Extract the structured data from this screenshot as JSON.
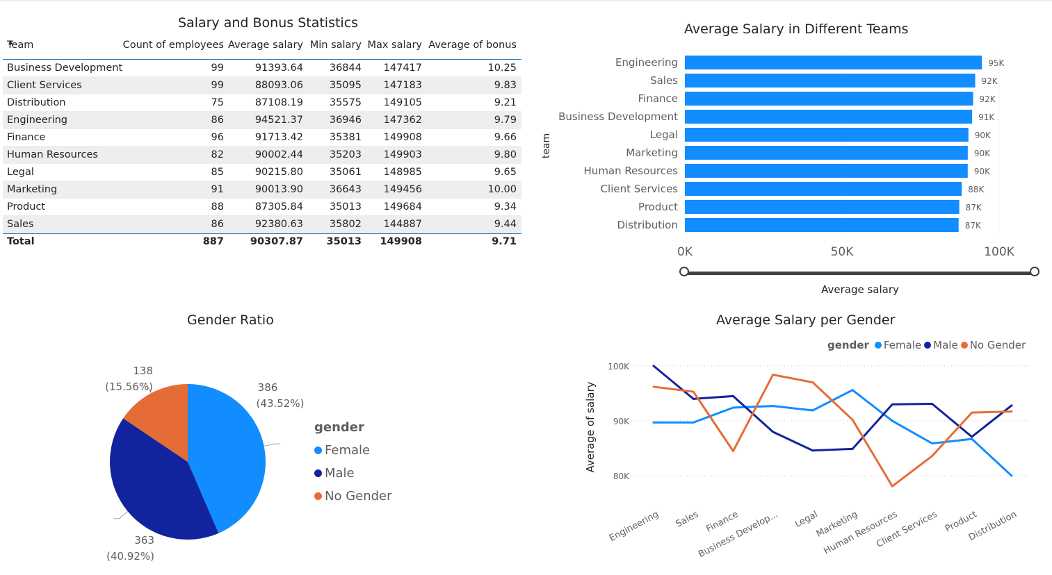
{
  "table": {
    "title": "Salary and Bonus Statistics",
    "columns": [
      "Team",
      "Count of employees",
      "Average salary",
      "Min salary",
      "Max salary",
      "Average of bonus"
    ],
    "rows": [
      [
        "Business Development",
        "99",
        "91393.64",
        "36844",
        "147417",
        "10.25"
      ],
      [
        "Client Services",
        "99",
        "88093.06",
        "35095",
        "147183",
        "9.83"
      ],
      [
        "Distribution",
        "75",
        "87108.19",
        "35575",
        "149105",
        "9.21"
      ],
      [
        "Engineering",
        "86",
        "94521.37",
        "36946",
        "147362",
        "9.79"
      ],
      [
        "Finance",
        "96",
        "91713.42",
        "35381",
        "149908",
        "9.66"
      ],
      [
        "Human Resources",
        "82",
        "90002.44",
        "35203",
        "149903",
        "9.80"
      ],
      [
        "Legal",
        "85",
        "90215.80",
        "35061",
        "148985",
        "9.65"
      ],
      [
        "Marketing",
        "91",
        "90013.90",
        "36643",
        "149456",
        "10.00"
      ],
      [
        "Product",
        "88",
        "87305.84",
        "35013",
        "149684",
        "9.34"
      ],
      [
        "Sales",
        "86",
        "92380.63",
        "35802",
        "144887",
        "9.44"
      ]
    ],
    "total": [
      "Total",
      "887",
      "90307.87",
      "35013",
      "149908",
      "9.71"
    ]
  },
  "chart_data": [
    {
      "type": "bar",
      "orientation": "horizontal",
      "title": "Average Salary in Different Teams",
      "ylabel": "team",
      "xlabel": "Average salary",
      "categories": [
        "Engineering",
        "Sales",
        "Finance",
        "Business Development",
        "Legal",
        "Marketing",
        "Human Resources",
        "Client Services",
        "Product",
        "Distribution"
      ],
      "values": [
        94521.37,
        92380.63,
        91713.42,
        91393.64,
        90215.8,
        90013.9,
        90002.44,
        88093.06,
        87305.84,
        87108.19
      ],
      "data_labels": [
        "95K",
        "92K",
        "92K",
        "91K",
        "90K",
        "90K",
        "90K",
        "88K",
        "87K",
        "87K"
      ],
      "xlim": [
        0,
        100000
      ],
      "x_ticks": [
        0,
        50000,
        100000
      ],
      "x_tick_labels": [
        "0K",
        "50K",
        "100K"
      ],
      "color": "#118dff"
    },
    {
      "type": "pie",
      "title": "Gender Ratio",
      "legend_title": "gender",
      "slices": [
        {
          "label": "Female",
          "value": 386,
          "percent": "43.52%",
          "color": "#118dff"
        },
        {
          "label": "Male",
          "value": 363,
          "percent": "40.92%",
          "color": "#12239e"
        },
        {
          "label": "No Gender",
          "value": 138,
          "percent": "15.56%",
          "color": "#e66c37"
        }
      ]
    },
    {
      "type": "line",
      "title": "Average Salary per Gender",
      "ylabel": "Average of salary",
      "legend_title": "gender",
      "categories": [
        "Engineering",
        "Sales",
        "Finance",
        "Business Develop...",
        "Legal",
        "Marketing",
        "Human Resources",
        "Client Services",
        "Product",
        "Distribution"
      ],
      "ylim": [
        78000,
        101500
      ],
      "y_ticks": [
        80000,
        90000,
        100000
      ],
      "y_tick_labels": [
        "80K",
        "90K",
        "100K"
      ],
      "series": [
        {
          "name": "Female",
          "color": "#118dff",
          "values": [
            89700,
            89700,
            92400,
            92700,
            91900,
            95600,
            90000,
            85900,
            86700,
            80000
          ]
        },
        {
          "name": "Male",
          "color": "#12239e",
          "values": [
            100000,
            94000,
            94500,
            88000,
            84600,
            84900,
            93000,
            93100,
            87100,
            92800
          ]
        },
        {
          "name": "No Gender",
          "color": "#e66c37",
          "values": [
            96200,
            95300,
            84500,
            98400,
            97000,
            90200,
            78100,
            83600,
            91500,
            91700
          ]
        }
      ]
    }
  ]
}
